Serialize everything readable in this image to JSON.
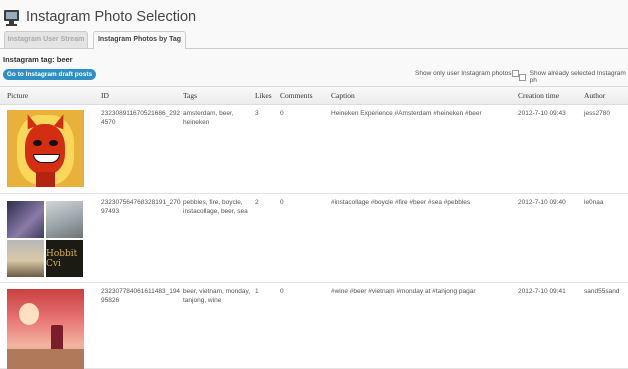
{
  "app": {
    "title": "Instagram Photo Selection"
  },
  "tabs": [
    {
      "label": "Instagram User Stream",
      "active": false
    },
    {
      "label": "Instagram Photos by Tag",
      "active": true
    }
  ],
  "tag_heading": "Instagram tag: beer",
  "draft_button": "Go to Instagram draft posts",
  "options": {
    "only_user": "Show only user Instagram photos",
    "already_selected": "Show already selected Instagram ph"
  },
  "table": {
    "headers": [
      "Picture",
      "ID",
      "Tags",
      "Likes",
      "Comments",
      "Caption",
      "Creation time",
      "Author"
    ],
    "rows": [
      {
        "picture": "devil-mascot-image",
        "id": "232308911670521686_2924570",
        "tags": "amsterdam, beer, heineken",
        "likes": "3",
        "comments": "0",
        "caption": "Heineken Experience #Amsterdam #heineken #beer",
        "time": "2012-7-10 09:43",
        "author": "jess2780"
      },
      {
        "picture": "collage-image",
        "id": "232307564768328191_27097493",
        "tags": "pebbles, fire, boycle, instacollage, beer, sea",
        "likes": "2",
        "comments": "0",
        "caption": "#instacollage #boycle #fire #beer #sea #pebbles",
        "time": "2012-7-10 09:40",
        "author": "le0naa",
        "collage_text": "Hobbit Cvi"
      },
      {
        "picture": "bar-scene-image",
        "id": "232307784061611483_19495826",
        "tags": "beer, vietnam, monday, tanjong, wine",
        "likes": "1",
        "comments": "0",
        "caption": "#wine #beer #vietnam #monday at #tanjong pagar",
        "time": "2012-7-10 09:41",
        "author": "sand55sand"
      }
    ]
  }
}
